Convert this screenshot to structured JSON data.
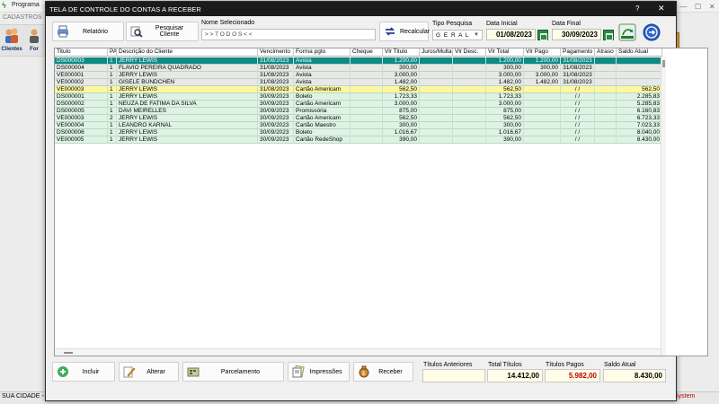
{
  "background": {
    "app_title": "Programa",
    "menu_label": "CADASTROS",
    "tools": [
      {
        "label": "Clientes",
        "icon": "users-icon"
      },
      {
        "label": "For",
        "icon": "supplier-icon"
      }
    ],
    "status_city": "SUA CIDADE -",
    "status_system": "System"
  },
  "window": {
    "title": "TELA DE CONTROLE DO CONTAS A RECEBER",
    "help": "?",
    "close": "✕"
  },
  "toolbar": {
    "relatorio": "Relatório",
    "pesquisar_cliente": "Pesquisar Cliente",
    "recalcular": "Recalcular"
  },
  "filters": {
    "nome_label": "Nome Selecionado",
    "nome_value": "> > T O D O S < <",
    "tipo_label": "Tipo  Pesquisa",
    "tipo_value": "G E R A L",
    "data_inicial_label": "Data Inicial",
    "data_inicial_value": "01/08/2023",
    "data_final_label": "Data Final",
    "data_final_value": "30/09/2023"
  },
  "table": {
    "columns": [
      "Titulo",
      "PA",
      "Descrição do Cliente",
      "Vencimento",
      "Forma pgto",
      "Cheque",
      "Vlr Titulo",
      "Juros/Multa",
      "Vlr Desc.",
      "Vlr Total",
      "Vlr Pago",
      "Pagamento",
      "Atraso",
      "Saldo Atual"
    ],
    "rows": [
      [
        "DS000003",
        "1",
        "JERRY LEWIS",
        "31/08/2023",
        "Avista",
        "",
        "1.200,00",
        "",
        "",
        "1.200,00",
        "1.200,00",
        "31/08/2023",
        "",
        ""
      ],
      [
        "DS000004",
        "1",
        "FLAVIO PEREIRA QUADRADO",
        "31/08/2023",
        "Avista",
        "",
        "300,00",
        "",
        "",
        "300,00",
        "300,00",
        "31/08/2023",
        "",
        ""
      ],
      [
        "VE000001",
        "1",
        "JERRY LEWIS",
        "31/08/2023",
        "Avista",
        "",
        "3.000,00",
        "",
        "",
        "3.000,00",
        "3.000,00",
        "31/08/2023",
        "",
        ""
      ],
      [
        "VE000002",
        "1",
        "GISELE BÜNDCHEN",
        "31/08/2023",
        "Avista",
        "",
        "1.482,00",
        "",
        "",
        "1.482,00",
        "1.482,00",
        "31/08/2023",
        "",
        ""
      ],
      [
        "VE000003",
        "1",
        "JERRY LEWIS",
        "31/08/2023",
        "Cartão Americam",
        "",
        "562,50",
        "",
        "",
        "562,50",
        "",
        "/  /",
        "",
        "562,50"
      ],
      [
        "DS000001",
        "1",
        "JERRY LEWIS",
        "30/09/2023",
        "Boleto",
        "",
        "1.723,33",
        "",
        "",
        "1.723,33",
        "",
        "/  /",
        "",
        "2.285,83"
      ],
      [
        "DS000002",
        "1",
        "NEUZA DE FATIMA DA SILVA",
        "30/09/2023",
        "Cartão Americam",
        "",
        "3.000,00",
        "",
        "",
        "3.000,00",
        "",
        "/  /",
        "",
        "5.285,83"
      ],
      [
        "DS000005",
        "1",
        "DAVI MEIRELLES",
        "30/09/2023",
        "Promissória",
        "",
        "875,00",
        "",
        "",
        "875,00",
        "",
        "/  /",
        "",
        "6.160,83"
      ],
      [
        "VE000003",
        "2",
        "JERRY LEWIS",
        "30/09/2023",
        "Cartão Americam",
        "",
        "562,50",
        "",
        "",
        "562,50",
        "",
        "/  /",
        "",
        "6.723,33"
      ],
      [
        "VE000004",
        "1",
        "LEANDRO KARNAL",
        "30/09/2023",
        "Cartão Maestro",
        "",
        "300,00",
        "",
        "",
        "300,00",
        "",
        "/  /",
        "",
        "7.023,33"
      ],
      [
        "DS000006",
        "1",
        "JERRY LEWIS",
        "30/09/2023",
        "Boleto",
        "",
        "1.016,67",
        "",
        "",
        "1.016,67",
        "",
        "/  /",
        "",
        "8.040,00"
      ],
      [
        "VE000005",
        "1",
        "JERRY LEWIS",
        "30/09/2023",
        "Cartão RedeShop",
        "",
        "390,00",
        "",
        "",
        "390,00",
        "",
        "/  /",
        "",
        "8.430,00"
      ]
    ]
  },
  "colors": {
    "row_selected": "#0f8a86",
    "row_paid": "#e8e8e8",
    "row_highlight": "#fff7a0",
    "row_open": "#dff3e4"
  },
  "bottom": {
    "incluir": "Incluir",
    "alterar": "Alterar",
    "parcelamento": "Parcelamento",
    "impressoes": "Impressões",
    "receber": "Receber"
  },
  "totals": {
    "anteriores_label": "Títulos Anteriores",
    "anteriores_value": "",
    "total_label": "Total Títulos",
    "total_value": "14.412,00",
    "pagos_label": "Títulos Pagos",
    "pagos_value": "5.982,00",
    "saldo_label": "Saldo Atual",
    "saldo_value": "8.430,00"
  }
}
